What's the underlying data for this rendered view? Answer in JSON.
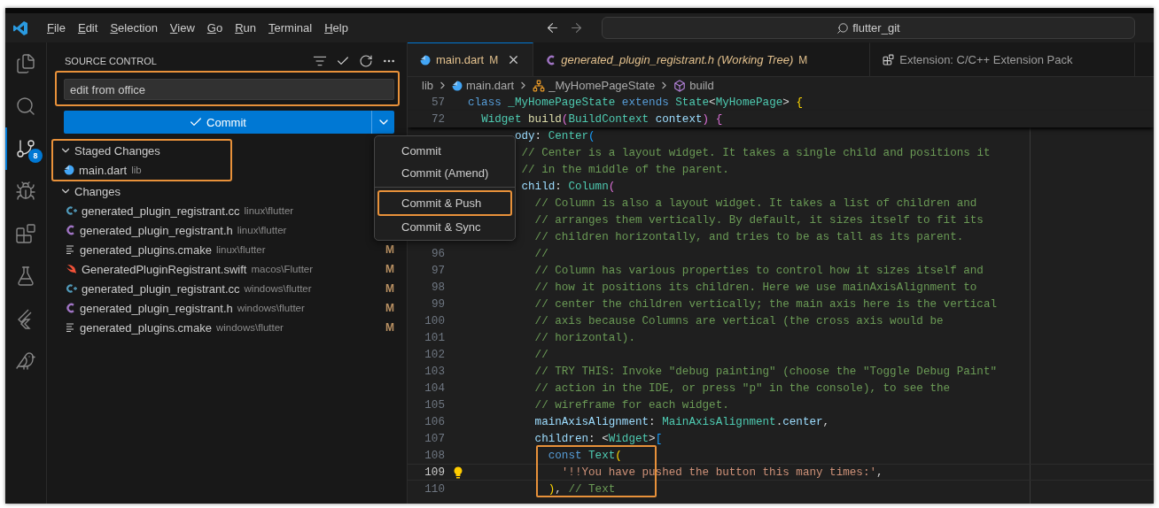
{
  "title_bar": {
    "menus": [
      "File",
      "Edit",
      "Selection",
      "View",
      "Go",
      "Run",
      "Terminal",
      "Help"
    ],
    "search": "flutter_git"
  },
  "activity_bar": [
    {
      "kind": "files",
      "selected": false
    },
    {
      "kind": "search",
      "selected": false
    },
    {
      "kind": "scm",
      "selected": true,
      "badge": "8"
    },
    {
      "kind": "debug",
      "selected": false
    },
    {
      "kind": "extensions",
      "selected": false
    },
    {
      "kind": "testing",
      "selected": false
    },
    {
      "kind": "flutter",
      "selected": false
    },
    {
      "kind": "bird",
      "selected": false
    }
  ],
  "source_control": {
    "title": "SOURCE CONTROL",
    "message": {
      "value": "edit from office",
      "highlighted": true
    },
    "commit_button": "Commit",
    "staged": {
      "label": "Staged Changes",
      "expanded": true,
      "highlighted": true,
      "files": [
        {
          "name": "main.dart",
          "path": "lib",
          "kind": "dart"
        }
      ]
    },
    "changes": {
      "label": "Changes",
      "expanded": true,
      "files": [
        {
          "name": "generated_plugin_registrant.cc",
          "path": "linux\\flutter",
          "kind": "cc"
        },
        {
          "name": "generated_plugin_registrant.h",
          "path": "linux\\flutter",
          "kind": "h"
        },
        {
          "name": "generated_plugins.cmake",
          "path": "linux\\flutter",
          "kind": "cmake",
          "status": "M"
        },
        {
          "name": "GeneratedPluginRegistrant.swift",
          "path": "macos\\Flutter",
          "kind": "swift",
          "status": "M"
        },
        {
          "name": "generated_plugin_registrant.cc",
          "path": "windows\\flutter",
          "kind": "cc",
          "status": "M"
        },
        {
          "name": "generated_plugin_registrant.h",
          "path": "windows\\flutter",
          "kind": "h",
          "status": "M"
        },
        {
          "name": "generated_plugins.cmake",
          "path": "windows\\flutter",
          "kind": "cmake",
          "status": "M"
        }
      ]
    }
  },
  "commit_menu": [
    {
      "kind": "item",
      "label": "Commit",
      "highlighted": false
    },
    {
      "kind": "item",
      "label": "Commit (Amend)",
      "highlighted": false
    },
    {
      "kind": "separator"
    },
    {
      "kind": "item",
      "label": "Commit & Push",
      "highlighted": true
    },
    {
      "kind": "item",
      "label": "Commit & Sync",
      "highlighted": false
    }
  ],
  "tabs": [
    {
      "label": "main.dart",
      "kind": "dart",
      "selected": true,
      "preview": false,
      "status": "M"
    },
    {
      "label": "generated_plugin_registrant.h (Working Tree)",
      "kind": "h",
      "selected": false,
      "preview": true,
      "status": "M"
    },
    {
      "label": "Extension: C/C++ Extension Pack",
      "kind": "extension",
      "selected": false,
      "preview": false
    }
  ],
  "breadcrumbs": [
    {
      "label": "lib",
      "kind": "folder"
    },
    {
      "label": "main.dart",
      "kind": "dart"
    },
    {
      "label": "_MyHomePageState",
      "kind": "class"
    },
    {
      "label": "build",
      "kind": "method"
    }
  ],
  "code": [
    {
      "num": "57",
      "sticky": true,
      "tokens": [
        {
          "t": "class ",
          "kind": "kw"
        },
        {
          "t": "_MyHomePageState ",
          "kind": "type"
        },
        {
          "t": "extends ",
          "kind": "kw"
        },
        {
          "t": "State",
          "kind": "type"
        },
        {
          "t": "<",
          "kind": "p"
        },
        {
          "t": "MyHomePage",
          "kind": "type"
        },
        {
          "t": "> ",
          "kind": "p"
        },
        {
          "t": "{",
          "kind": "b1"
        }
      ]
    },
    {
      "num": "72",
      "sticky": true,
      "tokens": [
        {
          "t": "  Widget ",
          "kind": "type"
        },
        {
          "t": "build",
          "kind": "fn"
        },
        {
          "t": "(",
          "kind": "b2"
        },
        {
          "t": "BuildContext ",
          "kind": "type"
        },
        {
          "t": "context",
          "kind": "var"
        },
        {
          "t": ")",
          "kind": "b2"
        },
        {
          "t": " {",
          "kind": "b2"
        }
      ]
    },
    {
      "tokens": [
        {
          "t": "       ody",
          "kind": "var"
        },
        {
          "t": ": ",
          "kind": "p"
        },
        {
          "t": "Center",
          "kind": "type"
        },
        {
          "t": "(",
          "kind": "b3"
        }
      ]
    },
    {
      "tokens": [
        {
          "t": "        // Center is a layout widget. It takes a single child and positions it",
          "kind": "cmt"
        }
      ]
    },
    {
      "tokens": [
        {
          "t": "        // in the middle of the parent.",
          "kind": "cmt"
        }
      ]
    },
    {
      "tokens": [
        {
          "t": "        child",
          "kind": "var"
        },
        {
          "t": ": ",
          "kind": "p"
        },
        {
          "t": "Column",
          "kind": "type"
        },
        {
          "t": "(",
          "kind": "b2"
        }
      ]
    },
    {
      "tokens": [
        {
          "t": "          // Column is also a layout widget. It takes a list of children and",
          "kind": "cmt"
        }
      ]
    },
    {
      "tokens": [
        {
          "t": "          // arranges them vertically. By default, it sizes itself to fit its",
          "kind": "cmt"
        }
      ]
    },
    {
      "tokens": [
        {
          "t": "          // children horizontally, and tries to be as tall as its parent.",
          "kind": "cmt"
        }
      ]
    },
    {
      "num": "96",
      "tokens": [
        {
          "t": "          //",
          "kind": "cmt"
        }
      ]
    },
    {
      "num": "97",
      "tokens": [
        {
          "t": "          // Column has various properties to control how it sizes itself and",
          "kind": "cmt"
        }
      ]
    },
    {
      "num": "98",
      "tokens": [
        {
          "t": "          // how it positions its children. Here we use mainAxisAlignment to",
          "kind": "cmt"
        }
      ]
    },
    {
      "num": "99",
      "tokens": [
        {
          "t": "          // center the children vertically; the main axis here is the vertical",
          "kind": "cmt"
        }
      ]
    },
    {
      "num": "100",
      "tokens": [
        {
          "t": "          // axis because Columns are vertical (the cross axis would be",
          "kind": "cmt"
        }
      ]
    },
    {
      "num": "101",
      "tokens": [
        {
          "t": "          // horizontal).",
          "kind": "cmt"
        }
      ]
    },
    {
      "num": "102",
      "tokens": [
        {
          "t": "          //",
          "kind": "cmt"
        }
      ]
    },
    {
      "num": "103",
      "tokens": [
        {
          "t": "          // TRY THIS: Invoke \"debug painting\" (choose the \"Toggle Debug Paint\"",
          "kind": "cmt"
        }
      ]
    },
    {
      "num": "104",
      "tokens": [
        {
          "t": "          // action in the IDE, or press \"p\" in the console), to see the",
          "kind": "cmt"
        }
      ]
    },
    {
      "num": "105",
      "tokens": [
        {
          "t": "          // wireframe for each widget.",
          "kind": "cmt"
        }
      ]
    },
    {
      "num": "106",
      "tokens": [
        {
          "t": "          mainAxisAlignment",
          "kind": "var"
        },
        {
          "t": ": ",
          "kind": "p"
        },
        {
          "t": "MainAxisAlignment",
          "kind": "type"
        },
        {
          "t": ".",
          "kind": "p"
        },
        {
          "t": "center",
          "kind": "var"
        },
        {
          "t": ",",
          "kind": "p"
        }
      ]
    },
    {
      "num": "107",
      "tokens": [
        {
          "t": "          children",
          "kind": "var"
        },
        {
          "t": ": ",
          "kind": "p"
        },
        {
          "t": "<",
          "kind": "p"
        },
        {
          "t": "Widget",
          "kind": "type"
        },
        {
          "t": ">",
          "kind": "p"
        },
        {
          "t": "[",
          "kind": "b3"
        }
      ]
    },
    {
      "num": "108",
      "highlighted": true,
      "tokens": [
        {
          "t": "            const ",
          "kind": "kw"
        },
        {
          "t": "Text",
          "kind": "type"
        },
        {
          "t": "(",
          "kind": "b1"
        }
      ]
    },
    {
      "num": "109",
      "highlighted": true,
      "current": true,
      "lightbulb": true,
      "tokens": [
        {
          "t": "              '!!You have pushed the button this many times:'",
          "kind": "str"
        },
        {
          "t": ",",
          "kind": "p"
        }
      ]
    },
    {
      "num": "110",
      "highlighted": true,
      "tokens": [
        {
          "t": "            )",
          "kind": "b1"
        },
        {
          "t": ", ",
          "kind": "p"
        },
        {
          "t": "// Text",
          "kind": "cmt"
        }
      ]
    }
  ]
}
